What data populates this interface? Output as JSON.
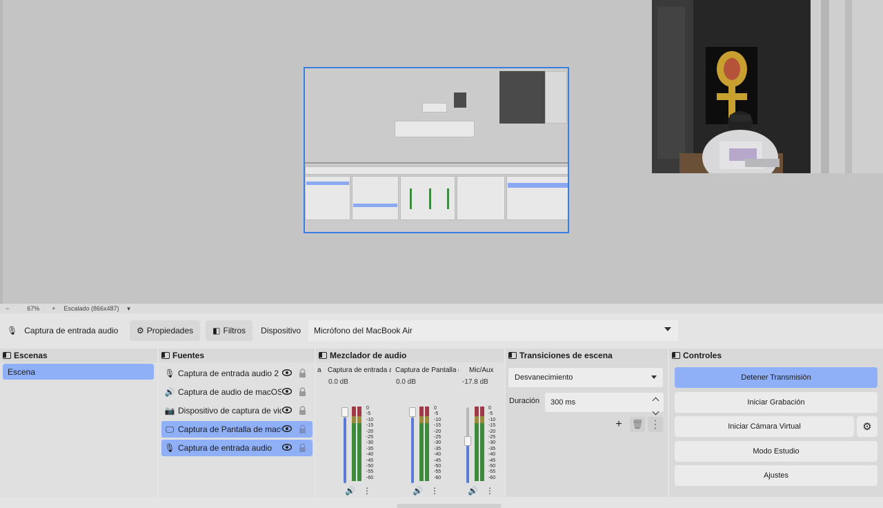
{
  "preview": {
    "zoom": "67%",
    "zoom_minus": "−",
    "zoom_plus": "+",
    "scaling": "Escalado (866x487)"
  },
  "context": {
    "source_name": "Captura de entrada audio",
    "properties_label": "Propiedades",
    "filters_label": "Filtros",
    "device_label": "Dispositivo",
    "device_value": "Micrófono del MacBook Air"
  },
  "scenes": {
    "title": "Escenas",
    "items": [
      {
        "label": "Escena"
      }
    ]
  },
  "sources": {
    "title": "Fuentes",
    "items": [
      {
        "label": "Captura de entrada audio 2",
        "icon": "microphone-icon"
      },
      {
        "label": "Captura de audio de macOS",
        "icon": "speaker-icon"
      },
      {
        "label": "Dispositivo de captura de vid",
        "icon": "camera-icon"
      },
      {
        "label": "Captura de Pantalla de macO",
        "icon": "monitor-icon"
      },
      {
        "label": "Captura de entrada audio",
        "icon": "microphone-icon"
      }
    ]
  },
  "mixer": {
    "title": "Mezclador de audio",
    "cut_label": "a",
    "channels": [
      {
        "name": "Captura de entrada a",
        "db": "0.0 dB",
        "level": 0.8
      },
      {
        "name": "Captura de Pantalla d",
        "db": "0.0 dB",
        "level": 0.8
      },
      {
        "name": "Mic/Aux",
        "db": "-17.8 dB",
        "level": 0.5
      }
    ],
    "ticks": [
      "0",
      "-5",
      "-10",
      "-15",
      "-20",
      "-25",
      "-30",
      "-35",
      "-40",
      "-45",
      "-50",
      "-55",
      "-60"
    ]
  },
  "transitions": {
    "title": "Transiciones de escena",
    "selected": "Desvanecimiento",
    "duration_label": "Duración",
    "duration_value": "300 ms"
  },
  "controls": {
    "title": "Controles",
    "stop_stream": "Detener Transmisión",
    "start_recording": "Iniciar Grabación",
    "start_virtual_cam": "Iniciar Cámara Virtual",
    "studio_mode": "Modo Estudio",
    "settings": "Ajustes"
  },
  "colors": {
    "accent": "#8fb0f7",
    "selection_border": "#3a7fe0"
  }
}
